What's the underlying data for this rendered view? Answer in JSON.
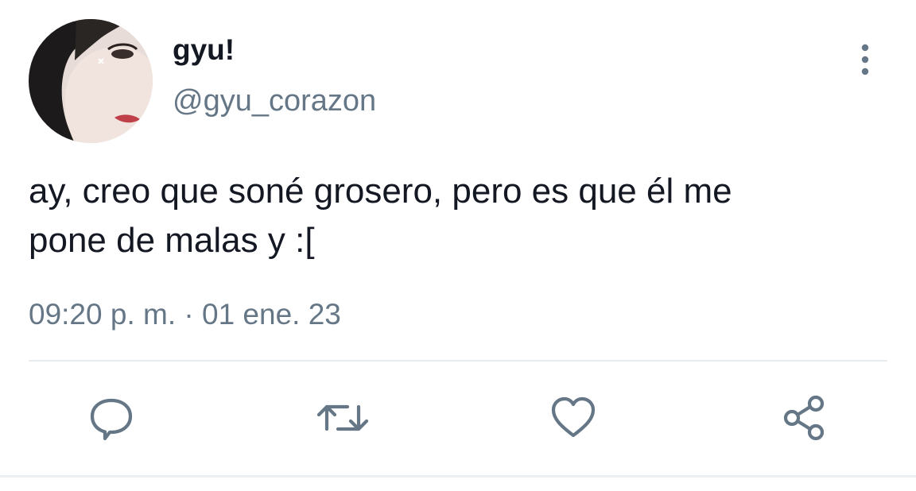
{
  "tweet": {
    "display_name": "gyu!",
    "handle": "@gyu_corazon",
    "text_line1": "ay, creo que soné grosero, pero es que él me",
    "text_line2": "pone de malas y :[",
    "timestamp": "09:20 p. m. · 01 ene. 23"
  },
  "icons": {
    "more": "more-vertical-icon",
    "reply": "reply-bubble-icon",
    "retweet": "retweet-icon",
    "like": "heart-icon",
    "share": "share-icon"
  },
  "colors": {
    "text": "#141823",
    "secondary": "#657786",
    "icon": "#657786",
    "divider": "#e6ecf0"
  }
}
